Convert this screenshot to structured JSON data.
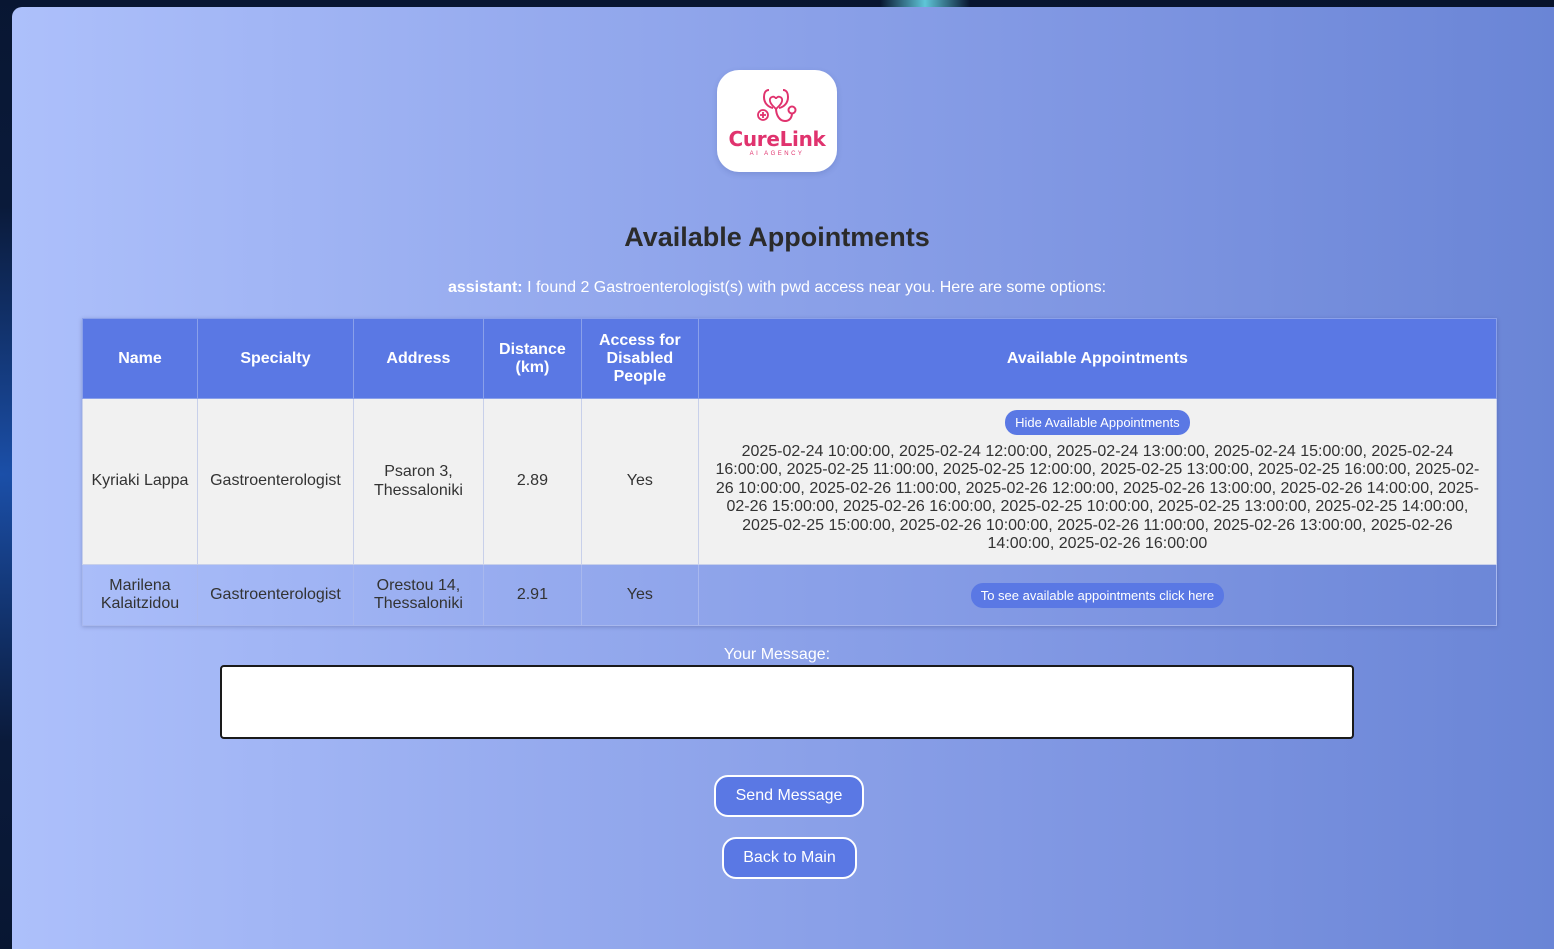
{
  "logo": {
    "name": "CureLink",
    "tagline": "AI AGENCY",
    "colors": {
      "brand": "#e0336e"
    }
  },
  "page": {
    "title": "Available Appointments",
    "assistant_prefix": "assistant:",
    "assistant_message": " I found 2 Gastroenterologist(s) with pwd access near you. Here are some options:"
  },
  "table": {
    "headers": [
      "Name",
      "Specialty",
      "Address",
      "Distance (km)",
      "Access for Disabled People",
      "Available Appointments"
    ],
    "rows": [
      {
        "name": "Kyriaki Lappa",
        "specialty": "Gastroenterologist",
        "address": "Psaron 3, Thessaloniki",
        "distance": "2.89",
        "access": "Yes",
        "button": "Hide Available Appointments",
        "appointments": "2025-02-24 10:00:00, 2025-02-24 12:00:00, 2025-02-24 13:00:00, 2025-02-24 15:00:00, 2025-02-24 16:00:00, 2025-02-25 11:00:00, 2025-02-25 12:00:00, 2025-02-25 13:00:00, 2025-02-25 16:00:00, 2025-02-26 10:00:00, 2025-02-26 11:00:00, 2025-02-26 12:00:00, 2025-02-26 13:00:00, 2025-02-26 14:00:00, 2025-02-26 15:00:00, 2025-02-26 16:00:00, 2025-02-25 10:00:00, 2025-02-25 13:00:00, 2025-02-25 14:00:00, 2025-02-25 15:00:00, 2025-02-26 10:00:00, 2025-02-26 11:00:00, 2025-02-26 13:00:00, 2025-02-26 14:00:00, 2025-02-26 16:00:00"
      },
      {
        "name": "Marilena Kalaitzidou",
        "specialty": "Gastroenterologist",
        "address": "Orestou 14, Thessaloniki",
        "distance": "2.91",
        "access": "Yes",
        "button": "To see available appointments click here"
      }
    ]
  },
  "form": {
    "message_label": "Your Message:",
    "message_value": "",
    "send_label": "Send Message",
    "back_label": "Back to Main"
  },
  "colors": {
    "accent": "#5a78e4",
    "header_bg": "#5a78e4",
    "row_light": "#f1f1f1"
  }
}
